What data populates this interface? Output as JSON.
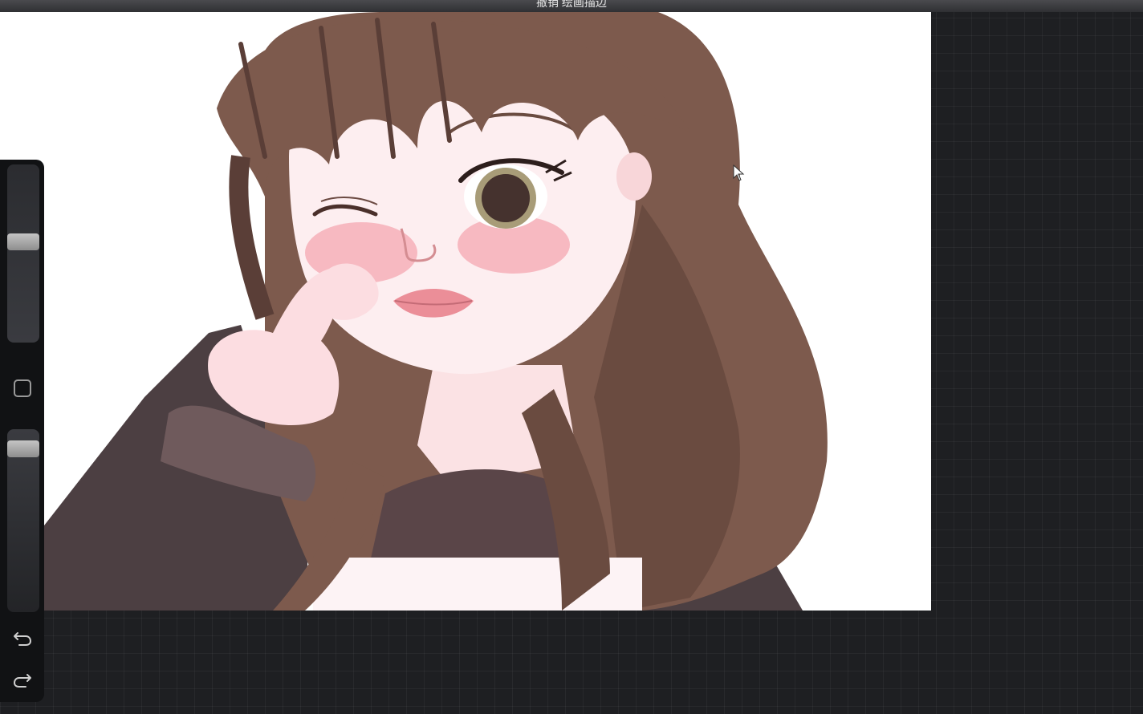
{
  "title_bar": {
    "text": "撤销 绘画描边"
  },
  "sidebar": {
    "brush_size_level": 0.57,
    "brush_opacity_level": 0.93,
    "modify_icon": "square-outline-icon",
    "undo_icon": "undo-arrow-icon",
    "redo_icon": "redo-arrow-icon"
  },
  "colors": {
    "background": "#1e1f22",
    "canvas": "#ffffff",
    "hair": "#7d5a4d",
    "hair_shadow": "#5a3e37",
    "skin": "#fdeef0",
    "blush": "#f2a3ad",
    "sweater": "#4c3f42"
  }
}
